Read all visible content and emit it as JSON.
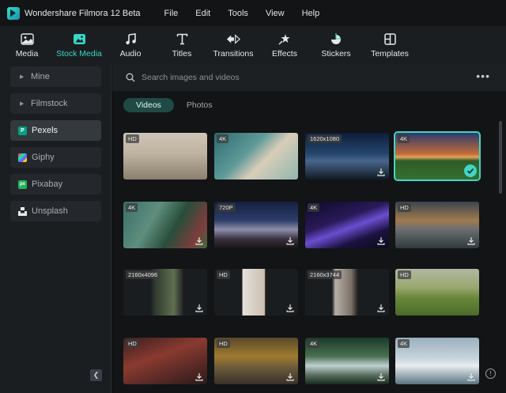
{
  "app": {
    "title": "Wondershare Filmora 12 Beta"
  },
  "menu": [
    "File",
    "Edit",
    "Tools",
    "View",
    "Help"
  ],
  "toolbar": [
    {
      "label": "Media",
      "icon": "media-icon"
    },
    {
      "label": "Stock Media",
      "icon": "stock-media-icon",
      "active": true
    },
    {
      "label": "Audio",
      "icon": "audio-icon"
    },
    {
      "label": "Titles",
      "icon": "titles-icon"
    },
    {
      "label": "Transitions",
      "icon": "transitions-icon"
    },
    {
      "label": "Effects",
      "icon": "effects-icon"
    },
    {
      "label": "Stickers",
      "icon": "stickers-icon"
    },
    {
      "label": "Templates",
      "icon": "templates-icon"
    }
  ],
  "sidebar": {
    "items": [
      {
        "label": "Mine",
        "icon": "caret-right-icon"
      },
      {
        "label": "Filmstock",
        "icon": "caret-right-icon"
      },
      {
        "label": "Pexels",
        "icon": "pexels-icon",
        "active": true
      },
      {
        "label": "Giphy",
        "icon": "giphy-icon"
      },
      {
        "label": "Pixabay",
        "icon": "pixabay-icon"
      },
      {
        "label": "Unsplash",
        "icon": "unsplash-icon"
      }
    ]
  },
  "search": {
    "placeholder": "Search images and videos"
  },
  "tabs": [
    {
      "label": "Videos",
      "active": true
    },
    {
      "label": "Photos"
    }
  ],
  "thumbnails": [
    {
      "badge": "HD",
      "download": false
    },
    {
      "badge": "4K",
      "download": false
    },
    {
      "badge": "1620x1080",
      "download": true
    },
    {
      "badge": "4K",
      "download": false,
      "selected": true
    },
    {
      "badge": "4K",
      "download": true
    },
    {
      "badge": "720P",
      "download": true
    },
    {
      "badge": "4K",
      "download": true
    },
    {
      "badge": "HD",
      "download": true
    },
    {
      "badge": "2160x4096",
      "download": true
    },
    {
      "badge": "HD",
      "download": true
    },
    {
      "badge": "2160x3744",
      "download": true
    },
    {
      "badge": "HD",
      "download": false
    },
    {
      "badge": "HD",
      "download": true
    },
    {
      "badge": "HD",
      "download": true
    },
    {
      "badge": "4K",
      "download": true
    },
    {
      "badge": "4K",
      "download": true
    }
  ],
  "colors": {
    "accent": "#38d6c4",
    "background": "#121416",
    "panel": "#1b1e21"
  }
}
